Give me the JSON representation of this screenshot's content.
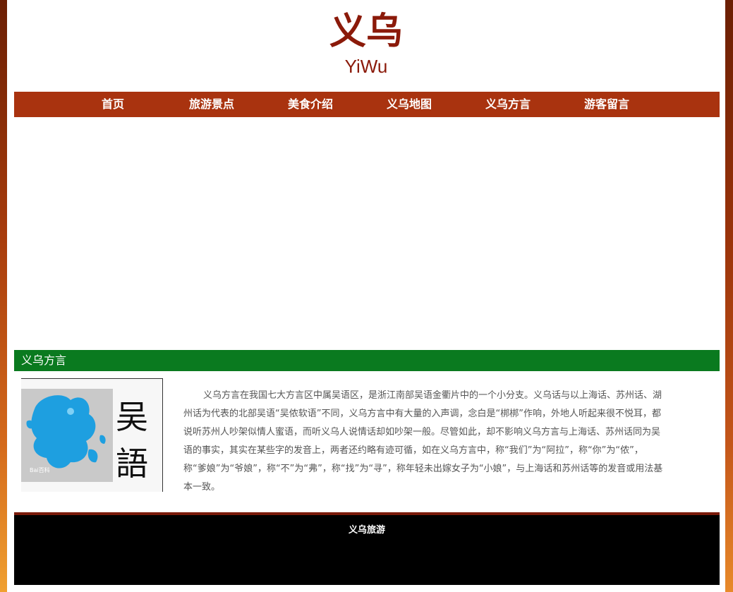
{
  "header": {
    "title": "义乌",
    "subtitle": "YiWu"
  },
  "nav": {
    "items": [
      {
        "label": "首页"
      },
      {
        "label": "旅游景点"
      },
      {
        "label": "美食介绍"
      },
      {
        "label": "义乌地图"
      },
      {
        "label": "义乌方言"
      },
      {
        "label": "游客留言"
      }
    ]
  },
  "section": {
    "title": "义乌方言"
  },
  "image": {
    "characters": "吴語",
    "watermark": "Bai百科"
  },
  "article": {
    "text": "义乌方言在我国七大方言区中属吴语区，是浙江南部吴语金衢片中的一个小分支。义乌话与以上海话、苏州话、湖州话为代表的北部吴语“吴侬软语”不同，义乌方言中有大量的入声调，念白是“梆梆”作响，外地人听起来很不悦耳，都说听苏州人吵架似情人蜜语，而听义乌人说情话却如吵架一般。尽管如此，却不影响义乌方言与上海话、苏州话同为吴语的事实，其实在某些字的发音上，两者还约略有迹可循，如在义乌方言中，称“我们”为“阿拉”，称“你”为“侬”，称“爹娘”为“爷娘”，称“不”为“弗”，称“找”为“寻”，称年轻未出嫁女子为“小娘”，与上海话和苏州话等的发音或用法基本一致。"
  },
  "footer": {
    "text": "义乌旅游"
  }
}
